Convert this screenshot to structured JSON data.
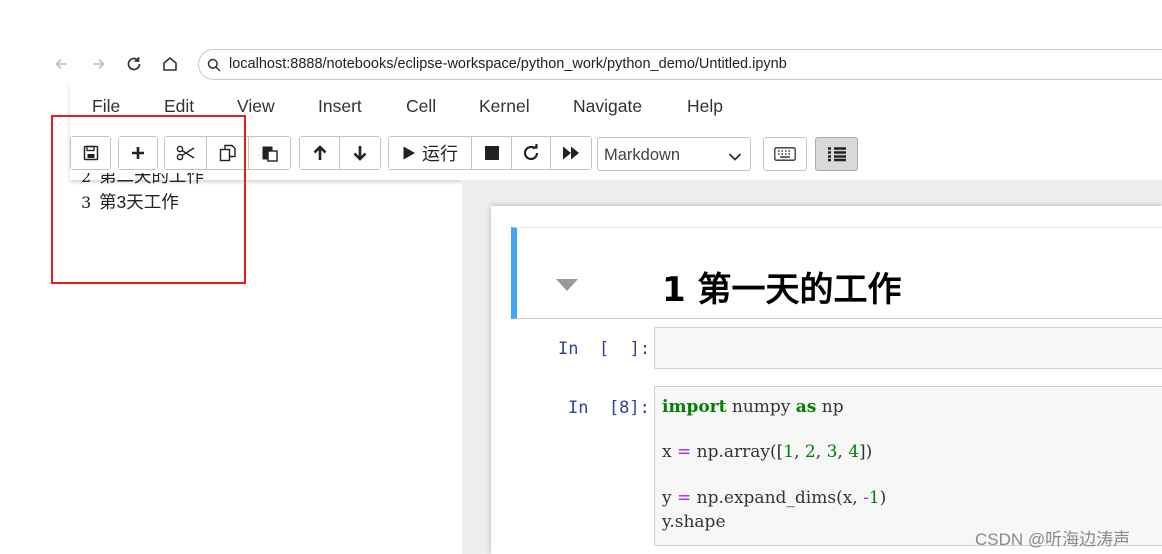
{
  "browser": {
    "url": "localhost:8888/notebooks/eclipse-workspace/python_work/python_demo/Untitled.ipynb"
  },
  "menu": [
    "File",
    "Edit",
    "View",
    "Insert",
    "Cell",
    "Kernel",
    "Navigate",
    "Help"
  ],
  "toolbar": {
    "run_label": "运行",
    "cell_type": "Markdown"
  },
  "toc": {
    "items": [
      {
        "num": "2",
        "label": "第二天的工作"
      },
      {
        "num": "3",
        "label": "第3天工作"
      }
    ]
  },
  "notebook": {
    "heading": "1  第一天的工作",
    "cells": [
      {
        "prompt": "In  [  ]:"
      },
      {
        "prompt": "In  [8]:"
      }
    ],
    "code": {
      "l1_kw1": "import",
      "l1_mod": " numpy ",
      "l1_kw2": "as",
      "l1_alias": " np",
      "l2_a": "x ",
      "l2_op": "=",
      "l2_b": " np.array([",
      "l2_n1": "1",
      "l2_c1": ", ",
      "l2_n2": "2",
      "l2_c2": ", ",
      "l2_n3": "3",
      "l2_c3": ", ",
      "l2_n4": "4",
      "l2_end": "])",
      "l3_a": "y ",
      "l3_op": "=",
      "l3_b": " np.expand_dims(x, ",
      "l3_neg": "-",
      "l3_n": "1",
      "l3_end": ")",
      "l4": "y.shape"
    }
  },
  "watermark": "CSDN @听海边涛声",
  "colors": {
    "accent_blue": "#42a5f5",
    "annotation_red": "#e02020",
    "prompt_blue": "#303f9f",
    "keyword_green": "#008000",
    "operator_purple": "#aa22ff"
  }
}
